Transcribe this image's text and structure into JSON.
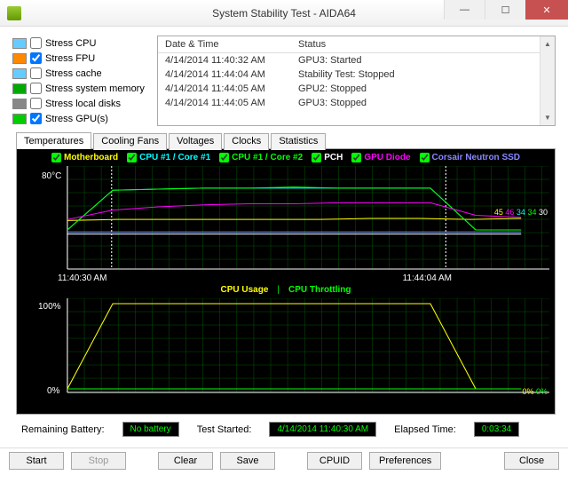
{
  "window": {
    "title": "System Stability Test - AIDA64"
  },
  "stress": {
    "items": [
      {
        "label": "Stress CPU",
        "checked": false
      },
      {
        "label": "Stress FPU",
        "checked": true
      },
      {
        "label": "Stress cache",
        "checked": false
      },
      {
        "label": "Stress system memory",
        "checked": false
      },
      {
        "label": "Stress local disks",
        "checked": false
      },
      {
        "label": "Stress GPU(s)",
        "checked": true
      }
    ]
  },
  "events": {
    "head_date": "Date & Time",
    "head_status": "Status",
    "rows": [
      {
        "dt": "4/14/2014 11:40:32 AM",
        "st": "GPU3: Started"
      },
      {
        "dt": "4/14/2014 11:44:04 AM",
        "st": "Stability Test: Stopped"
      },
      {
        "dt": "4/14/2014 11:44:05 AM",
        "st": "GPU2: Stopped"
      },
      {
        "dt": "4/14/2014 11:44:05 AM",
        "st": "GPU3: Stopped"
      }
    ]
  },
  "tabs": [
    "Temperatures",
    "Cooling Fans",
    "Voltages",
    "Clocks",
    "Statistics"
  ],
  "legend1": [
    {
      "label": "Motherboard",
      "color": "#ffff00"
    },
    {
      "label": "CPU #1 / Core #1",
      "color": "#00ffff"
    },
    {
      "label": "CPU #1 / Core #2",
      "color": "#00ff00"
    },
    {
      "label": "PCH",
      "color": "#ffffff"
    },
    {
      "label": "GPU Diode",
      "color": "#ff00ff"
    },
    {
      "label": "Corsair Neutron SSD",
      "color": "#8888ff"
    }
  ],
  "legend2": [
    {
      "label": "CPU Usage",
      "color": "#ffff00"
    },
    {
      "label": "CPU Throttling",
      "color": "#00ff00"
    }
  ],
  "chart_data": {
    "temp_chart": {
      "type": "line",
      "ylabel": "°C",
      "ylim": [
        0,
        90
      ],
      "ytick": "80°C",
      "xstart": "11:40:30 AM",
      "xend": "11:44:04 AM",
      "right_labels": [
        {
          "v": "45",
          "c": "#ffff00"
        },
        {
          "v": "46",
          "c": "#ff00ff"
        },
        {
          "v": "34",
          "c": "#00ffff"
        },
        {
          "v": "34",
          "c": "#00ff00"
        },
        {
          "v": "30",
          "c": "#ffffff"
        }
      ],
      "series": [
        {
          "name": "Motherboard",
          "color": "#ffff00",
          "approx": [
            43,
            44,
            44,
            44,
            44,
            44,
            45,
            45,
            44,
            45
          ]
        },
        {
          "name": "CPU #1 / Core #1",
          "color": "#00ffff",
          "approx": [
            34,
            72,
            73,
            74,
            74,
            74,
            74,
            74,
            74,
            34,
            34
          ]
        },
        {
          "name": "CPU #1 / Core #2",
          "color": "#00ff00",
          "approx": [
            34,
            72,
            73,
            74,
            74,
            75,
            74,
            74,
            74,
            34,
            34
          ]
        },
        {
          "name": "PCH",
          "color": "#ffffff",
          "approx": [
            30,
            30,
            30,
            30,
            30,
            30,
            30,
            30,
            30,
            30,
            30
          ]
        },
        {
          "name": "GPU Diode",
          "color": "#ff00ff",
          "approx": [
            44,
            53,
            56,
            58,
            59,
            59,
            60,
            60,
            60,
            48,
            46
          ]
        },
        {
          "name": "Corsair Neutron SSD",
          "color": "#8888ff",
          "approx": [
            32,
            32,
            32,
            32,
            32,
            32,
            32,
            32,
            32,
            32,
            32
          ]
        }
      ]
    },
    "usage_chart": {
      "type": "line",
      "ylim": [
        0,
        100
      ],
      "yticks": [
        "100%",
        "0%"
      ],
      "right_labels": [
        {
          "v": "0%",
          "c": "#ffff00"
        },
        {
          "v": "0%",
          "c": "#00ff00"
        }
      ],
      "series": [
        {
          "name": "CPU Usage",
          "color": "#ffff00",
          "approx": [
            0,
            100,
            100,
            100,
            100,
            100,
            100,
            100,
            100,
            0,
            0
          ]
        },
        {
          "name": "CPU Throttling",
          "color": "#00ff00",
          "approx": [
            0,
            0,
            0,
            0,
            0,
            0,
            0,
            0,
            0,
            0,
            0
          ]
        }
      ]
    }
  },
  "status": {
    "battery_lbl": "Remaining Battery:",
    "battery_val": "No battery",
    "started_lbl": "Test Started:",
    "started_val": "4/14/2014 11:40:30 AM",
    "elapsed_lbl": "Elapsed Time:",
    "elapsed_val": "0:03:34"
  },
  "buttons": {
    "start": "Start",
    "stop": "Stop",
    "clear": "Clear",
    "save": "Save",
    "cpuid": "CPUID",
    "prefs": "Preferences",
    "close": "Close"
  }
}
